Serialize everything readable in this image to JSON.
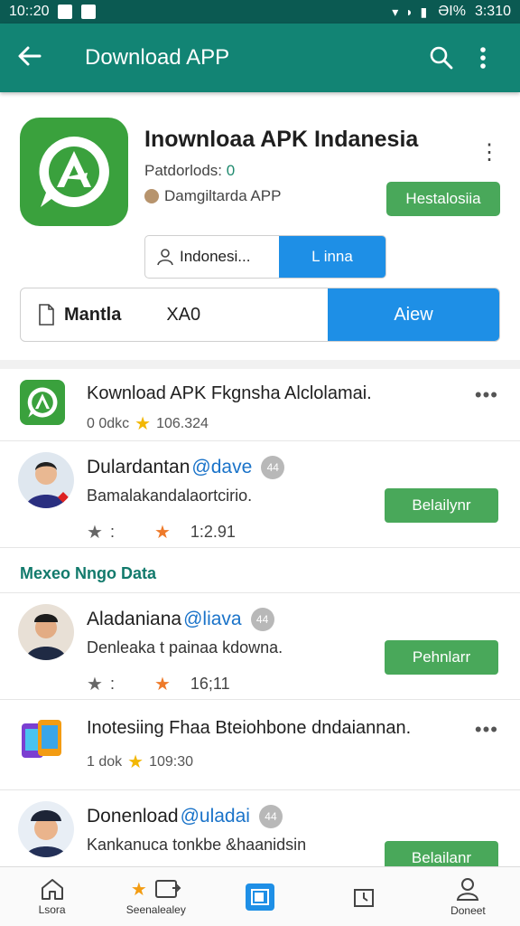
{
  "status_bar": {
    "time": "10::20",
    "battery": "ƏI%",
    "clock": "3:310"
  },
  "app_bar": {
    "title": "Download APP"
  },
  "header": {
    "title": "Inownloaa APK Indanesia",
    "downloads_label": "Patdorlods:",
    "downloads_count": "0",
    "developer": "Damgiltarda APP",
    "install_label": "Hestalosiia",
    "seg_small": {
      "left_label": "Indonesi...",
      "right_label": "L inna"
    },
    "seg_big": {
      "left_name": "Mantla",
      "left_meta": "XA0",
      "right_label": "Aiew"
    }
  },
  "feed": [
    {
      "type": "app",
      "title": "Kownload APK Fkgnsha Alclolamai.",
      "meta_count": "0 0dkc",
      "rating": "106.324"
    },
    {
      "type": "user",
      "name": "Dulardantan",
      "handle": "@dave",
      "badge": "44",
      "bio": "Bamalakandalaortcirio.",
      "stat": "1:2.91",
      "button": "Belailynr"
    }
  ],
  "section_title": "Mexeo Nngo Data",
  "feed2": [
    {
      "type": "user",
      "name": "Aladaniana",
      "handle": "@liava",
      "badge": "44",
      "bio": "Denleaka t painaa kdowna.",
      "stat": "16;11",
      "button": "Pehnlarr"
    },
    {
      "type": "app",
      "title": "Inotesiing Fhaa Bteiohbone dndaiannan.",
      "meta_count": "1 dok",
      "rating": "109:30"
    },
    {
      "type": "user",
      "name": "Donenload",
      "handle": "@uladai",
      "badge": "44",
      "bio": "Kankanuca tonkbe &haanidsin",
      "button": "Belailanr"
    }
  ],
  "bottom_nav": [
    {
      "label": "Lsora",
      "icon": "home-icon"
    },
    {
      "label": "Seenalealey",
      "icon": "store-icon"
    },
    {
      "label": "",
      "icon": "apps-icon",
      "active": true
    },
    {
      "label": "",
      "icon": "clock-icon"
    },
    {
      "label": "Doneet",
      "icon": "profile-icon"
    }
  ],
  "colors": {
    "appbar": "#128474",
    "statusbar": "#0b5a52",
    "accent_blue": "#1e8fe6",
    "green_button": "#49a85a",
    "section_teal": "#127a6c"
  }
}
